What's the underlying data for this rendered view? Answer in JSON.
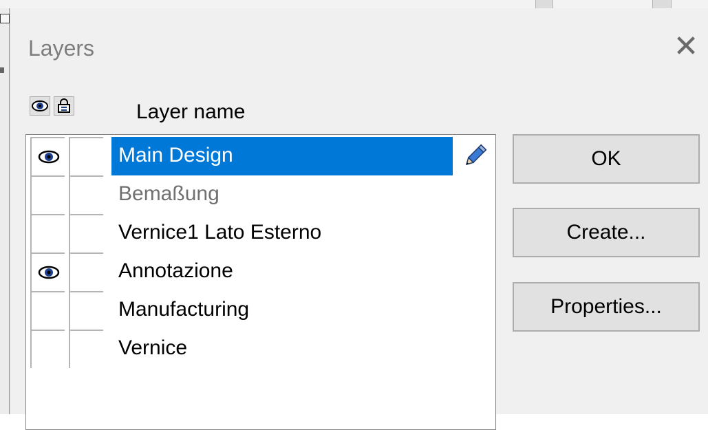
{
  "dialog": {
    "title": "Layers",
    "close_icon": "close-icon"
  },
  "header": {
    "visibility_icon": "eye-icon",
    "lock_icon": "lock-icon",
    "layer_name_label": "Layer name"
  },
  "layers": [
    {
      "name": "Main Design",
      "visible": true,
      "locked": false,
      "selected": true,
      "dimmed": false
    },
    {
      "name": "Bemaßung",
      "visible": false,
      "locked": false,
      "selected": false,
      "dimmed": true
    },
    {
      "name": "Vernice1 Lato Esterno",
      "visible": false,
      "locked": false,
      "selected": false,
      "dimmed": false
    },
    {
      "name": "Annotazione",
      "visible": true,
      "locked": false,
      "selected": false,
      "dimmed": false
    },
    {
      "name": "Manufacturing",
      "visible": false,
      "locked": false,
      "selected": false,
      "dimmed": false
    },
    {
      "name": "Vernice",
      "visible": false,
      "locked": false,
      "selected": false,
      "dimmed": false
    }
  ],
  "buttons": {
    "ok": "OK",
    "create": "Create...",
    "properties": "Properties..."
  },
  "colors": {
    "selection": "#0078d7",
    "dialog_bg": "#f0f0f0",
    "button_bg": "#e1e1e1"
  }
}
